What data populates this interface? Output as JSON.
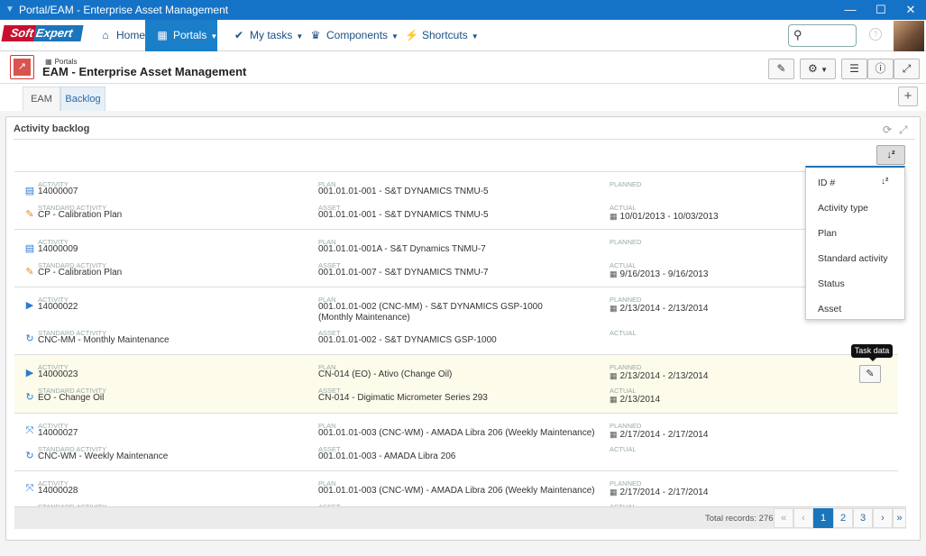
{
  "window": {
    "title": "Portal/EAM - Enterprise Asset Management"
  },
  "nav": {
    "logo_left": "Soft",
    "logo_right": "Expert",
    "items": [
      {
        "label": "Home",
        "icon": "home-icon"
      },
      {
        "label": "Portals",
        "icon": "portals-icon"
      },
      {
        "label": "My tasks",
        "icon": "check-icon"
      },
      {
        "label": "Components",
        "icon": "trophy-icon"
      },
      {
        "label": "Shortcuts",
        "icon": "lightning-icon"
      }
    ],
    "search_placeholder": ""
  },
  "header": {
    "breadcrumb": "Portals",
    "title": "EAM - Enterprise Asset Management"
  },
  "tabs": [
    {
      "label": "EAM"
    },
    {
      "label": "Backlog"
    }
  ],
  "panel": {
    "title": "Activity backlog"
  },
  "labels": {
    "activity": "ACTIVITY",
    "standard_activity": "STANDARD ACTIVITY",
    "plan": "PLAN",
    "asset": "ASSET",
    "planned": "PLANNED",
    "actual": "ACTUAL"
  },
  "rows": [
    {
      "activity": "14000007",
      "std_activity": "CP - Calibration Plan",
      "plan": "001.01.01-001 - S&T DYNAMICS TNMU-5",
      "asset": "001.01.01-001 - S&T DYNAMICS TNMU-5",
      "planned": "",
      "actual": "10/01/2013  -  10/03/2013",
      "icon": "clipboard-icon",
      "std_icon": "wrench-icon"
    },
    {
      "activity": "14000009",
      "std_activity": "CP - Calibration Plan",
      "plan": "001.01.01-001A - S&T Dynamics TNMU-7",
      "asset": "001.01.01-007 - S&T DYNAMICS TNMU-7",
      "planned": "",
      "actual": "9/16/2013  -  9/16/2013",
      "icon": "clipboard-icon",
      "std_icon": "wrench-icon"
    },
    {
      "activity": "14000022",
      "std_activity": "CNC-MM - Monthly Maintenance",
      "plan": "001.01.01-002 (CNC-MM) - S&T DYNAMICS GSP-1000 (Monthly Maintenance)",
      "asset": "001.01.01-002 - S&T DYNAMICS GSP-1000",
      "planned": "2/13/2014  -  2/13/2014",
      "actual": "",
      "icon": "play-icon",
      "std_icon": "cycle-icon"
    },
    {
      "activity": "14000023",
      "std_activity": "EO - Change Oil",
      "plan": "CN-014 (EO) - Ativo (Change Oil)",
      "asset": "CN-014 - Digimatic Micrometer Series 293",
      "planned": "2/13/2014  -  2/13/2014",
      "actual": "2/13/2014",
      "icon": "play-icon",
      "std_icon": "cycle-icon"
    },
    {
      "activity": "14000027",
      "std_activity": "CNC-WM - Weekly Maintenance",
      "plan": "001.01.01-003 (CNC-WM) - AMADA Libra 206 (Weekly Maintenance)",
      "asset": "001.01.01-003 - AMADA Libra 206",
      "planned": "2/17/2014  -  2/17/2014",
      "actual": "",
      "icon": "pending-icon",
      "std_icon": "cycle-icon"
    },
    {
      "activity": "14000028",
      "std_activity": "",
      "plan": "001.01.01-003 (CNC-WM) - AMADA Libra 206 (Weekly Maintenance)",
      "asset": "",
      "planned": "2/17/2014  -  2/17/2014",
      "actual": "",
      "icon": "pending-icon",
      "std_icon": "cycle-icon"
    }
  ],
  "tooltip": "Task data",
  "footer": {
    "total": "Total records: 276",
    "pages": [
      "«",
      "‹",
      "1",
      "2",
      "3",
      "›",
      "»"
    ],
    "current_page": "1"
  },
  "sort_menu": {
    "items": [
      "ID #",
      "Activity type",
      "Plan",
      "Standard activity",
      "Status",
      "Asset"
    ],
    "selected": "ID #"
  },
  "colors": {
    "accent": "#1b75bb",
    "titlebar": "#1573c7",
    "highlight_row": "#fdfbea"
  }
}
